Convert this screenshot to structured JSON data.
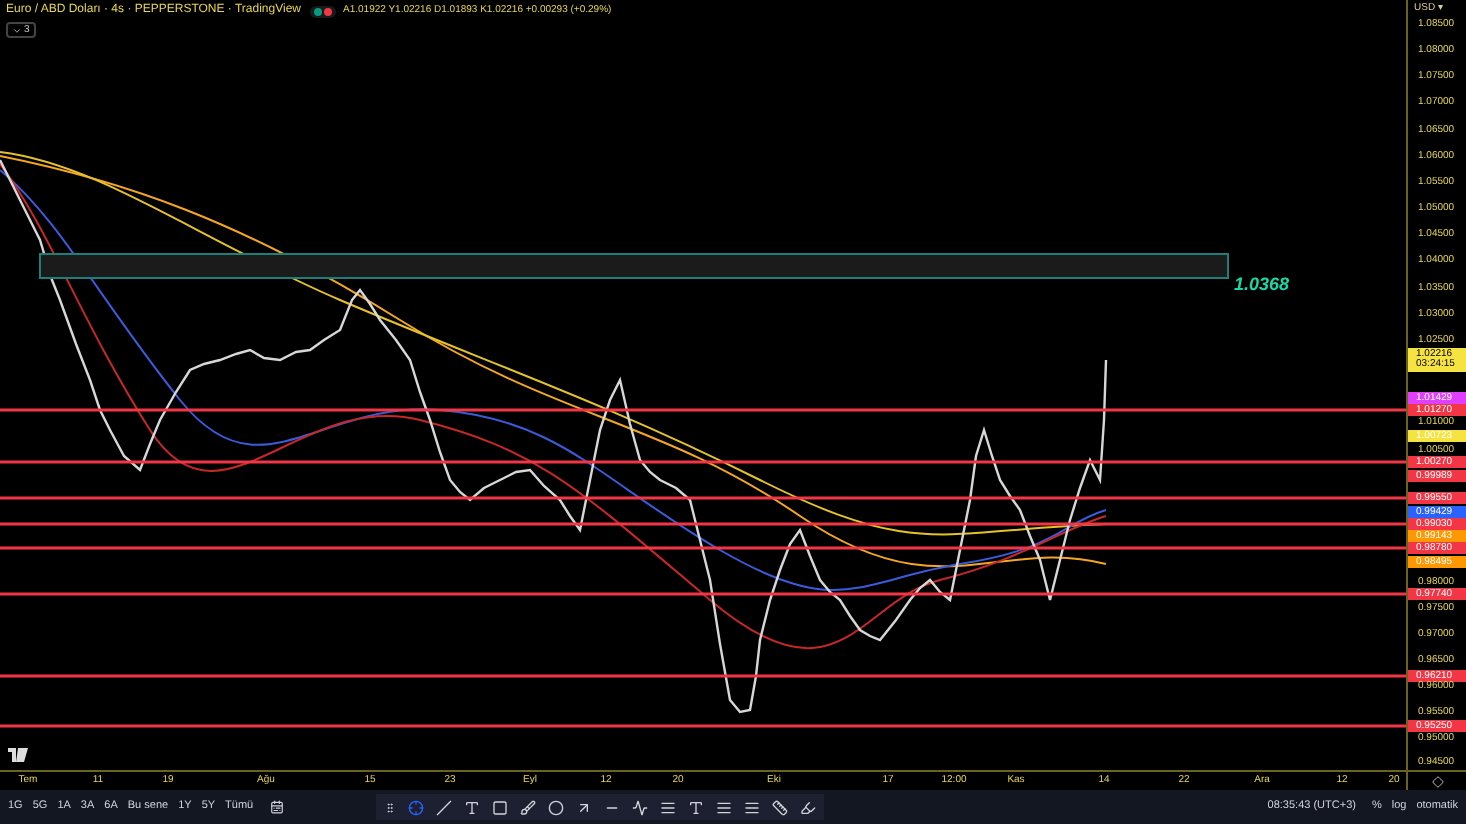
{
  "header": {
    "title": "Euro / ABD Doları · 4s · PEPPERSTONE · TradingView",
    "status_dots": [
      {
        "color": "#089981"
      },
      {
        "color": "#f23645"
      }
    ],
    "ohlc": "A1.01922 Y1.02216 D1.01893 K1.02216 +0.00293 (+0.29%)",
    "indicators_count": "3"
  },
  "zone": {
    "label": "1.0368"
  },
  "price_axis": {
    "currency": "USD ▾",
    "items": [
      {
        "kind": "label",
        "text": "1.08500"
      },
      {
        "kind": "label",
        "text": "1.08000"
      },
      {
        "kind": "label",
        "text": "1.07500"
      },
      {
        "kind": "label",
        "text": "1.07000"
      },
      {
        "kind": "label",
        "text": "1.06500"
      },
      {
        "kind": "label",
        "text": "1.06000"
      },
      {
        "kind": "label",
        "text": "1.05500"
      },
      {
        "kind": "label",
        "text": "1.05000"
      },
      {
        "kind": "label",
        "text": "1.04500"
      },
      {
        "kind": "label",
        "text": "1.04000"
      },
      {
        "kind": "label",
        "text": "1.03500"
      },
      {
        "kind": "label",
        "text": "1.03000"
      },
      {
        "kind": "label",
        "text": "1.02500"
      },
      {
        "kind": "current",
        "text": "1.02216",
        "countdown": "03:24:15",
        "color": "#f5e342"
      },
      {
        "kind": "tag",
        "text": "1.01429",
        "color": "#e040fb",
        "line": false
      },
      {
        "kind": "tag",
        "text": "1.01270",
        "color": "#f23645",
        "line": true
      },
      {
        "kind": "label",
        "text": "1.01000"
      },
      {
        "kind": "tag",
        "text": "1.00723",
        "color": "#f5e342",
        "line": false
      },
      {
        "kind": "label",
        "text": "1.00500"
      },
      {
        "kind": "tag",
        "text": "1.00270",
        "color": "#f23645",
        "line": true
      },
      {
        "kind": "tag",
        "text": "0.99989",
        "color": "#f23645",
        "line": false
      },
      {
        "kind": "tag",
        "text": "0.99550",
        "color": "#f23645",
        "line": true
      },
      {
        "kind": "tag",
        "text": "0.99429",
        "color": "#2962ff",
        "line": false
      },
      {
        "kind": "tag",
        "text": "0.99030",
        "color": "#f23645",
        "line": true
      },
      {
        "kind": "tag",
        "text": "0.99143",
        "color": "#ff9800",
        "line": false
      },
      {
        "kind": "tag",
        "text": "0.98780",
        "color": "#f23645",
        "line": true
      },
      {
        "kind": "tag",
        "text": "0.98495",
        "color": "#ff9800",
        "line": false
      },
      {
        "kind": "label",
        "text": "0.98000"
      },
      {
        "kind": "tag",
        "text": "0.97740",
        "color": "#f23645",
        "line": true
      },
      {
        "kind": "label",
        "text": "0.97500"
      },
      {
        "kind": "label",
        "text": "0.97000"
      },
      {
        "kind": "label",
        "text": "0.96500"
      },
      {
        "kind": "tag",
        "text": "0.96210",
        "color": "#f23645",
        "line": true
      },
      {
        "kind": "label",
        "text": "0.96000"
      },
      {
        "kind": "label",
        "text": "0.95500"
      },
      {
        "kind": "tag",
        "text": "0.95250",
        "color": "#f23645",
        "line": true
      },
      {
        "kind": "label",
        "text": "0.95000"
      },
      {
        "kind": "label",
        "text": "0.94500"
      }
    ]
  },
  "time_axis": [
    "Tem",
    "11",
    "19",
    "Ağu",
    "15",
    "23",
    "Eyl",
    "12",
    "20",
    "Eki",
    "17",
    "12:00",
    "Kas",
    "14",
    "22",
    "Ara",
    "12",
    "20"
  ],
  "ranges": [
    "1G",
    "5G",
    "1A",
    "3A",
    "6A",
    "Bu sene",
    "1Y",
    "5Y",
    "Tümü"
  ],
  "clock": "08:35:43 (UTC+3)",
  "scale_options": [
    "%",
    "log",
    "otomatik"
  ]
}
